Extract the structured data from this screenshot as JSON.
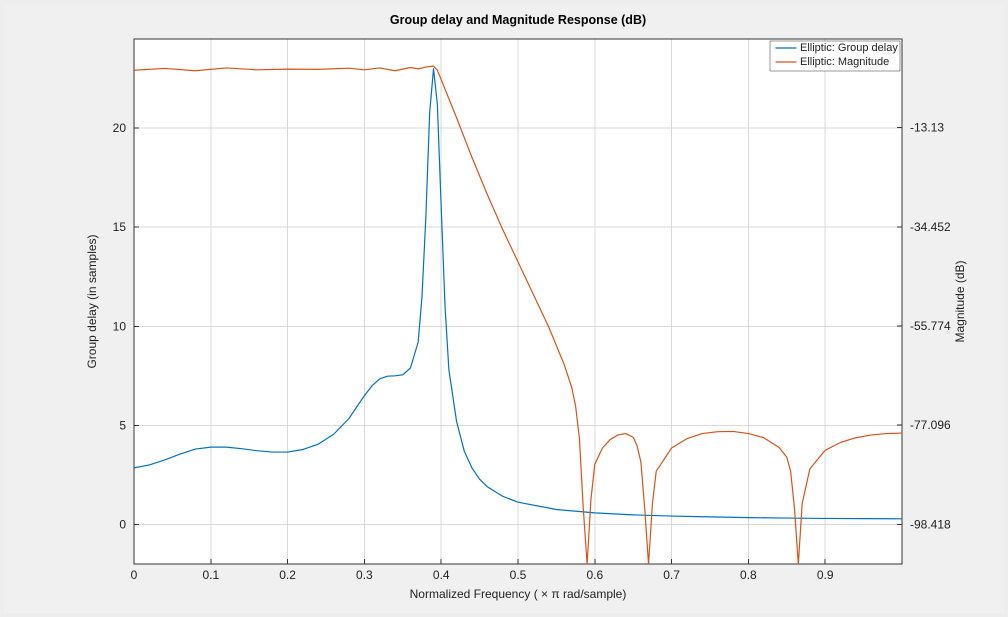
{
  "chart_data": {
    "type": "line",
    "title": "Group delay and Magnitude Response (dB)",
    "xlabel": "Normalized  Frequency  ( × π  rad/sample)",
    "ylabel_left": "Group delay (in samples)",
    "ylabel_right": "Magnitude (dB)",
    "xlim": [
      0,
      1
    ],
    "ylim_left": [
      -2,
      24.5
    ],
    "ylim_right": [
      -106.947,
      5.926
    ],
    "xticks": [
      0,
      0.1,
      0.2,
      0.3,
      0.4,
      0.5,
      0.6,
      0.7,
      0.8,
      0.9
    ],
    "yticks_left": [
      0,
      5,
      10,
      15,
      20
    ],
    "yticks_right": [
      -98.418,
      -77.096,
      -55.774,
      -34.452,
      -13.13
    ],
    "legend": [
      "Elliptic: Group delay",
      "Elliptic: Magnitude"
    ],
    "series": [
      {
        "name": "Elliptic: Group delay",
        "axis": "left",
        "color": "#0072BD",
        "x": [
          0.0,
          0.02,
          0.04,
          0.06,
          0.08,
          0.1,
          0.12,
          0.14,
          0.16,
          0.18,
          0.2,
          0.22,
          0.24,
          0.26,
          0.28,
          0.3,
          0.31,
          0.32,
          0.33,
          0.34,
          0.35,
          0.36,
          0.37,
          0.375,
          0.38,
          0.385,
          0.39,
          0.395,
          0.4,
          0.405,
          0.41,
          0.42,
          0.43,
          0.44,
          0.45,
          0.46,
          0.48,
          0.5,
          0.55,
          0.6,
          0.65,
          0.7,
          0.75,
          0.8,
          0.85,
          0.9,
          0.95,
          1.0
        ],
        "y": [
          2.85,
          3.0,
          3.25,
          3.55,
          3.8,
          3.9,
          3.9,
          3.82,
          3.72,
          3.65,
          3.65,
          3.78,
          4.05,
          4.55,
          5.35,
          6.5,
          7.0,
          7.35,
          7.48,
          7.5,
          7.55,
          7.9,
          9.2,
          11.5,
          15.5,
          20.8,
          23.0,
          21.2,
          16.0,
          11.0,
          7.8,
          5.2,
          3.7,
          2.85,
          2.28,
          1.9,
          1.42,
          1.12,
          0.75,
          0.58,
          0.48,
          0.42,
          0.38,
          0.34,
          0.32,
          0.3,
          0.29,
          0.28
        ]
      },
      {
        "name": "Elliptic: Magnitude",
        "axis": "right",
        "color": "#D95319",
        "x": [
          0.0,
          0.04,
          0.08,
          0.12,
          0.16,
          0.2,
          0.24,
          0.28,
          0.3,
          0.32,
          0.34,
          0.36,
          0.37,
          0.38,
          0.385,
          0.39,
          0.395,
          0.4,
          0.42,
          0.44,
          0.46,
          0.48,
          0.5,
          0.52,
          0.54,
          0.56,
          0.57,
          0.575,
          0.58,
          0.585,
          0.59,
          0.595,
          0.6,
          0.61,
          0.62,
          0.63,
          0.64,
          0.65,
          0.655,
          0.66,
          0.665,
          0.67,
          0.675,
          0.68,
          0.7,
          0.72,
          0.74,
          0.76,
          0.78,
          0.8,
          0.82,
          0.84,
          0.85,
          0.855,
          0.86,
          0.865,
          0.87,
          0.88,
          0.9,
          0.92,
          0.94,
          0.96,
          0.98,
          1.0
        ],
        "y": [
          -0.8,
          -0.4,
          -0.9,
          -0.3,
          -0.7,
          -0.55,
          -0.6,
          -0.35,
          -0.7,
          -0.3,
          -0.9,
          -0.2,
          -0.5,
          -0.1,
          0.0,
          0.1,
          -0.8,
          -2.8,
          -11.0,
          -19.5,
          -27.5,
          -35.0,
          -42.0,
          -49.0,
          -56.0,
          -64.0,
          -69.0,
          -73.0,
          -80.0,
          -95.0,
          -107.0,
          -93.0,
          -85.5,
          -82.0,
          -80.2,
          -79.2,
          -78.9,
          -79.7,
          -81.5,
          -85.0,
          -95.0,
          -107.0,
          -94.0,
          -87.0,
          -82.0,
          -80.0,
          -78.9,
          -78.5,
          -78.45,
          -78.9,
          -79.8,
          -81.9,
          -84.0,
          -87.0,
          -95.0,
          -107.0,
          -94.0,
          -86.5,
          -82.5,
          -80.8,
          -79.8,
          -79.2,
          -78.9,
          -78.8
        ]
      }
    ]
  }
}
